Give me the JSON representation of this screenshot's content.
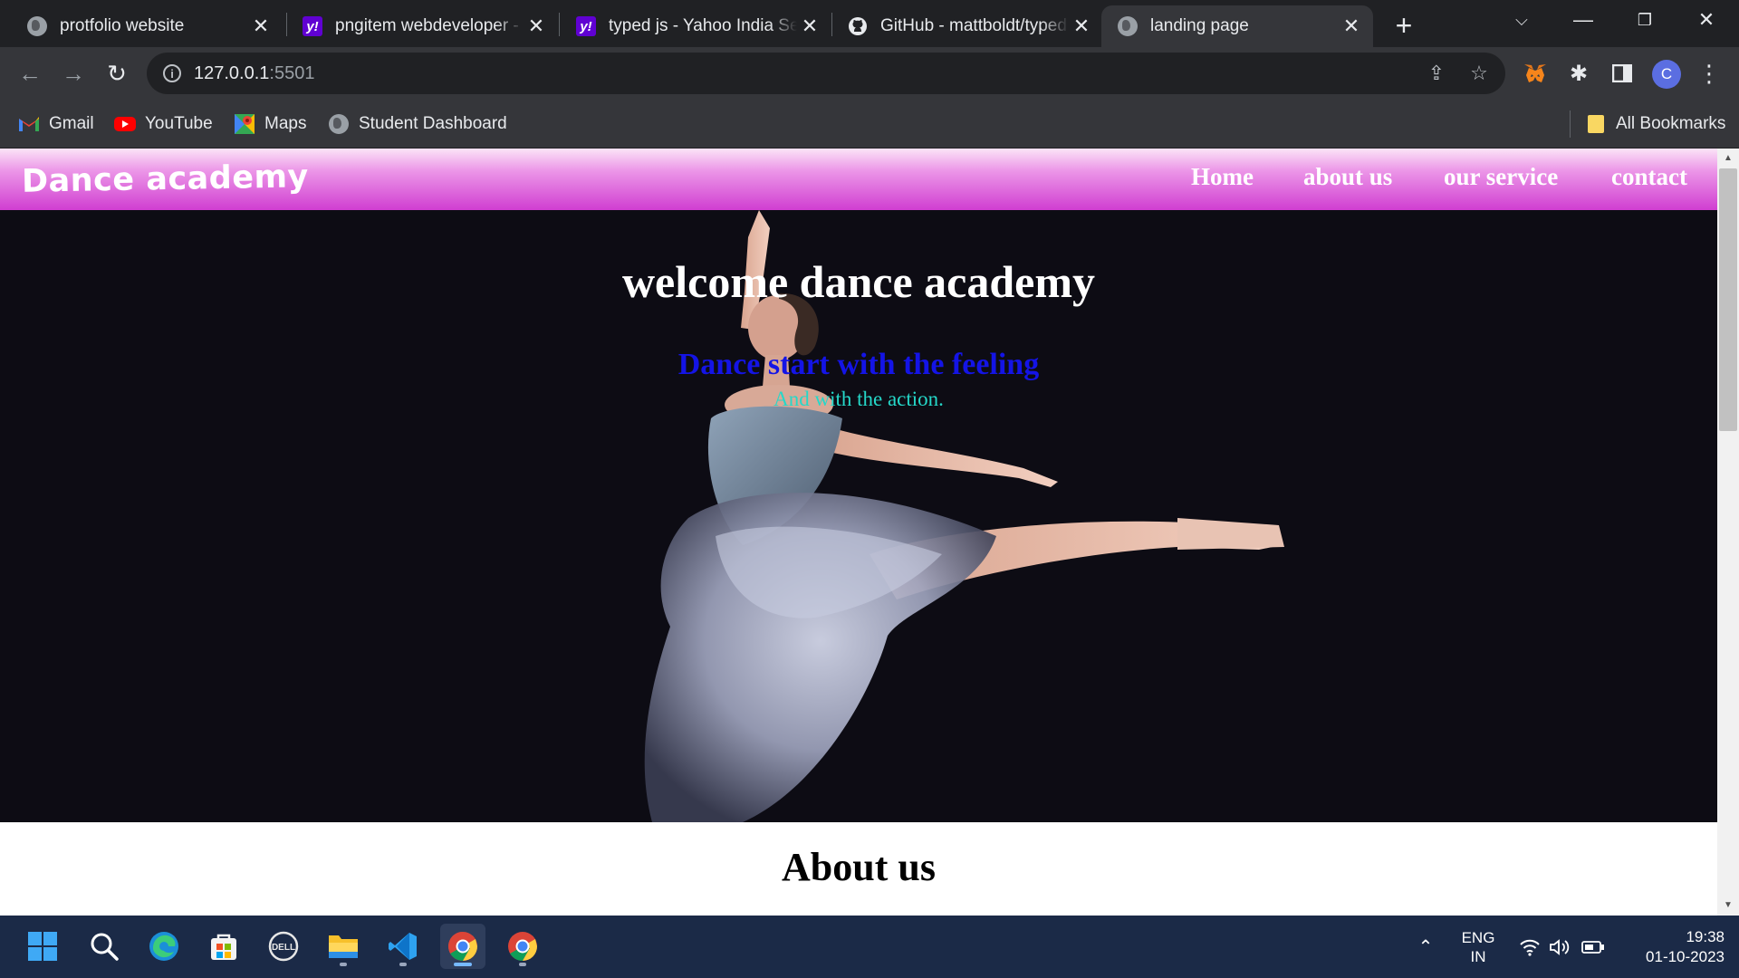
{
  "browser": {
    "tabs": [
      {
        "title": "protfolio website",
        "icon": "globe-icon",
        "active": false
      },
      {
        "title": "pngitem webdeveloper - Yahoo India Search",
        "icon": "yahoo-icon",
        "active": false
      },
      {
        "title": "typed js - Yahoo India Search",
        "icon": "yahoo-icon",
        "active": false
      },
      {
        "title": "GitHub - mattboldt/typed.js",
        "icon": "github-icon",
        "active": false
      },
      {
        "title": "landing page",
        "icon": "globe-icon",
        "active": true
      }
    ],
    "address": {
      "host": "127.0.0.1",
      "port": ":5501"
    },
    "profile_initial": "C",
    "bookmarks": [
      {
        "label": "Gmail",
        "icon": "gmail-icon"
      },
      {
        "label": "YouTube",
        "icon": "youtube-icon"
      },
      {
        "label": "Maps",
        "icon": "maps-icon"
      },
      {
        "label": "Student Dashboard",
        "icon": "globe-icon"
      }
    ],
    "all_bookmarks": "All Bookmarks"
  },
  "page": {
    "brand": "Dance academy",
    "nav": [
      "Home",
      "about us",
      "our service",
      "contact"
    ],
    "hero": {
      "title": "welcome dance academy",
      "tagline": "Dance start with the feeling",
      "subtitle": "And with the action."
    },
    "about_title": "About us",
    "colors": {
      "navbar": "#d03ed1",
      "tagline": "#1414e6",
      "subtitle": "#25d8c9",
      "hero_bg": "#0d0c14"
    }
  },
  "taskbar": {
    "apps": [
      "windows-start-icon",
      "search-icon",
      "edge-icon",
      "store-icon",
      "dell-icon",
      "file-explorer-icon",
      "vscode-icon",
      "chrome-icon",
      "chrome-icon"
    ],
    "language": {
      "line1": "ENG",
      "line2": "IN"
    },
    "time": "19:38",
    "date": "01-10-2023"
  }
}
